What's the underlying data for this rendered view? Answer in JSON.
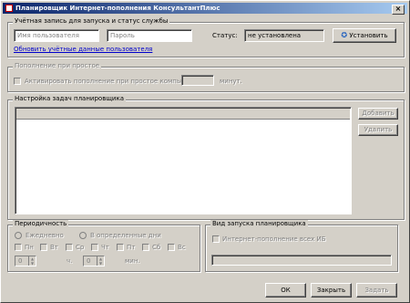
{
  "window": {
    "title": "Планировщик Интернет-пополнения КонсультантПлюс"
  },
  "account": {
    "group_label": "Учётная запись для запуска и статус службы",
    "username_placeholder": "Имя пользователя",
    "password_placeholder": "Пароль",
    "status_label": "Статус:",
    "status_value": "не установлена",
    "install_label": "Установить",
    "update_link": "Обновить учётные данные пользователя"
  },
  "idle": {
    "group_label": "Пополнение при простое",
    "checkbox_label": "Активировать пополнение при простое компьютера",
    "minutes_label": "минут."
  },
  "tasks": {
    "group_label": "Настройка задач планировщика",
    "add_label": "Добавить",
    "delete_label": "Удалить"
  },
  "period": {
    "group_label": "Периодичность",
    "daily_label": "Ежедневно",
    "days_label": "В определенные дни",
    "weekdays": [
      "Пн",
      "Вт",
      "Ср",
      "Чт",
      "Пт",
      "Сб",
      "Вс"
    ],
    "hours_value": "0",
    "hours_label": "ч.",
    "minutes_value": "0",
    "minutes_label": "мин."
  },
  "launch": {
    "group_label": "Вид запуска планировщика",
    "checkbox_label": "Интернет-пополнение всех ИБ"
  },
  "footer": {
    "ok_label": "ОК",
    "close_label": "Закрыть",
    "apply_label": "Задать"
  }
}
